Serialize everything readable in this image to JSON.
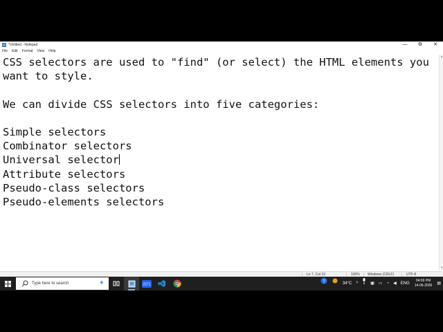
{
  "window": {
    "title": "*Untitled - Notepad",
    "controls": {
      "minimize": "—",
      "maximize": "⧉",
      "close": "✕"
    }
  },
  "menu": [
    "File",
    "Edit",
    "Format",
    "View",
    "Help"
  ],
  "document": {
    "lines": [
      "CSS selectors are used to \"find\" (or select) the HTML elements you",
      "want to style.",
      "",
      "We can divide CSS selectors into five categories:",
      "",
      "Simple selectors",
      "Combinator selectors",
      "Universal selector",
      "Attribute selectors",
      "Pseudo-class selectors",
      "Pseudo-elements selectors"
    ]
  },
  "status": {
    "position": "Ln 7, Col 19",
    "zoom": "100%",
    "line_endings": "Windows (CRLF)",
    "encoding": "UTF-8"
  },
  "taskbar": {
    "search_placeholder": "Type here to search",
    "weather_temp": "34°C",
    "language": "ENG",
    "time": "04:09 PM",
    "date": "14-06-2026",
    "badge_text": "2271"
  },
  "colors": {
    "taskbar": "#1f1f1f",
    "accent": "#7fb4ff",
    "vscode": "#1f8ad2",
    "chrome_red": "#db4437",
    "chrome_yellow": "#f4b400",
    "chrome_green": "#0f9d58"
  }
}
